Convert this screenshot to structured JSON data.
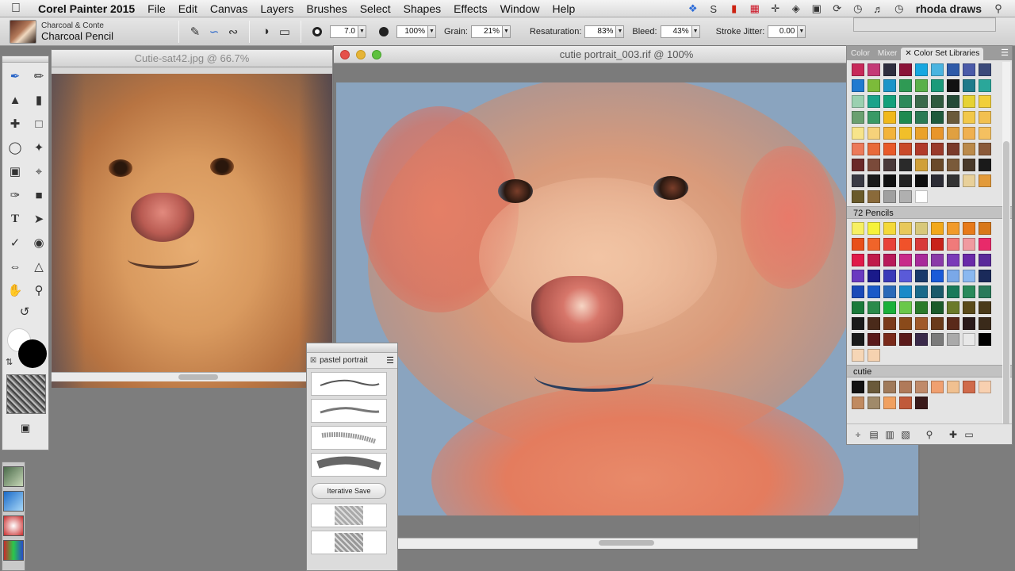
{
  "menubar": {
    "app_name": "Corel Painter 2015",
    "items": [
      "File",
      "Edit",
      "Canvas",
      "Layers",
      "Brushes",
      "Select",
      "Shapes",
      "Effects",
      "Window",
      "Help"
    ],
    "user": "rhoda draws"
  },
  "propbar": {
    "brush_category": "Charcoal & Conte",
    "brush_variant": "Charcoal Pencil",
    "size": "7.0",
    "opacity": "100%",
    "grain_label": "Grain:",
    "grain": "21%",
    "resaturation_label": "Resaturation:",
    "resaturation": "83%",
    "bleed_label": "Bleed:",
    "bleed": "43%",
    "jitter_label": "Stroke Jitter:",
    "jitter": "0.00"
  },
  "reference_window": {
    "title": "Cutie-sat42.jpg @ 66.7%"
  },
  "main_window": {
    "title": "cutie portrait_003.rif @ 100%"
  },
  "brush_panel": {
    "title": "pastel portrait",
    "iterative_save": "Iterative Save"
  },
  "color_panel": {
    "tabs": [
      "Color",
      "Mixer",
      "Color Set Libraries"
    ],
    "sets": [
      {
        "name": "",
        "colors": [
          "#c7295a",
          "#c43a76",
          "#2e2e3e",
          "#8a1238",
          "#17a7e0",
          "#4ab4e0",
          "#2e5aa8",
          "#4a5aa8",
          "#3b4a7a",
          "#1f7ad0",
          "#7cbb3a",
          "#1c94c8",
          "#2f9a54",
          "#5ab04a",
          "#1b9a7a",
          "#111111",
          "#1f7a8a",
          "#2aa79a",
          "#9ad0b0",
          "#1aa38a",
          "#14a07a",
          "#2d8a5a",
          "#3a6a4a",
          "#2f5a3e",
          "#244a36",
          "#e6d233",
          "#f1cf3a",
          "#6aa070",
          "#3a9a66",
          "#f0b81a",
          "#1e8a50",
          "#2a7a54",
          "#1f5a3c",
          "#6a5a3a",
          "#f2c84a",
          "#f2c050",
          "#f7e48a",
          "#f6d27a",
          "#f3b33a",
          "#f1bf2a",
          "#eaa22a",
          "#e8952a",
          "#e0a040",
          "#f0b050",
          "#f4c060",
          "#ec7a5a",
          "#e86a3a",
          "#e85a2a",
          "#c94a2a",
          "#b13a2a",
          "#9a3a2a",
          "#7a3a2a",
          "#bb8a4a",
          "#8a5a3a",
          "#6a2a2a",
          "#7a4a3a",
          "#4a3a3a",
          "#2a2a2a",
          "#d0a03a",
          "#6a4a2a",
          "#7a5a3a",
          "#4a3a2a",
          "#1a1a1a",
          "#3a3a44",
          "#1a1a1a",
          "#111111",
          "#222222",
          "#0d0d0d",
          "#2c2c34",
          "#333333",
          "#e8d09a",
          "#e29a3a",
          "#6a5a2a",
          "#8a6a3a",
          "#a0a0a0",
          "#b0b0b0",
          "#ffffff"
        ]
      },
      {
        "name": "72 Pencils",
        "colors": [
          "#f7f062",
          "#f6f23a",
          "#f4d93a",
          "#e8c85a",
          "#d8c87a",
          "#f2a81a",
          "#f19a2a",
          "#e77a1a",
          "#d8781a",
          "#e8501a",
          "#f0642a",
          "#e8423a",
          "#f0522a",
          "#d83a3a",
          "#c8231a",
          "#f07a7a",
          "#f09aa0",
          "#e82a6a",
          "#e01a4a",
          "#c01a4a",
          "#b81a5a",
          "#c82a8a",
          "#a82a9a",
          "#8a3aa8",
          "#7a3ab8",
          "#6a2aa8",
          "#5a2a9a",
          "#6a3ac0",
          "#1a1a8a",
          "#3a3ab8",
          "#5a5ad8",
          "#1a3a6a",
          "#1a5ad8",
          "#7aa8e8",
          "#8ab8f0",
          "#1a2a5a",
          "#1a4ab8",
          "#1a5ac8",
          "#2a6ab8",
          "#1a8ac8",
          "#1a6a8a",
          "#1a5a6a",
          "#1a7a5a",
          "#2a8a5a",
          "#2a7a5a",
          "#1a7a3a",
          "#2a8a4a",
          "#1ab03a",
          "#6ac84a",
          "#2a7a2a",
          "#1a5a2a",
          "#6a7a2a",
          "#5a4a1a",
          "#4a3a1a",
          "#1a1a1a",
          "#4a2a1a",
          "#7a3a1a",
          "#8a4a1a",
          "#a05a2a",
          "#6a3a1a",
          "#5a2a1a",
          "#2a1a1a",
          "#3a2a1a",
          "#1a1a1a",
          "#5a1a1a",
          "#7a2a1a",
          "#5a1a1a",
          "#3a2a4a",
          "#7a7a7a",
          "#aaaaaa",
          "#e8e8e8",
          "#000000",
          "#f6d6b6",
          "#f6d2b0"
        ]
      },
      {
        "name": "cutie",
        "colors": [
          "#111111",
          "#6a5a3a",
          "#a07a5a",
          "#b07a5a",
          "#c08a6a",
          "#f0a070",
          "#f0c090",
          "#d06a4a",
          "#f8d0b0",
          "#c08a60",
          "#a08a6a",
          "#f0a060",
          "#c05a3a",
          "#3a1a1a"
        ]
      }
    ]
  }
}
